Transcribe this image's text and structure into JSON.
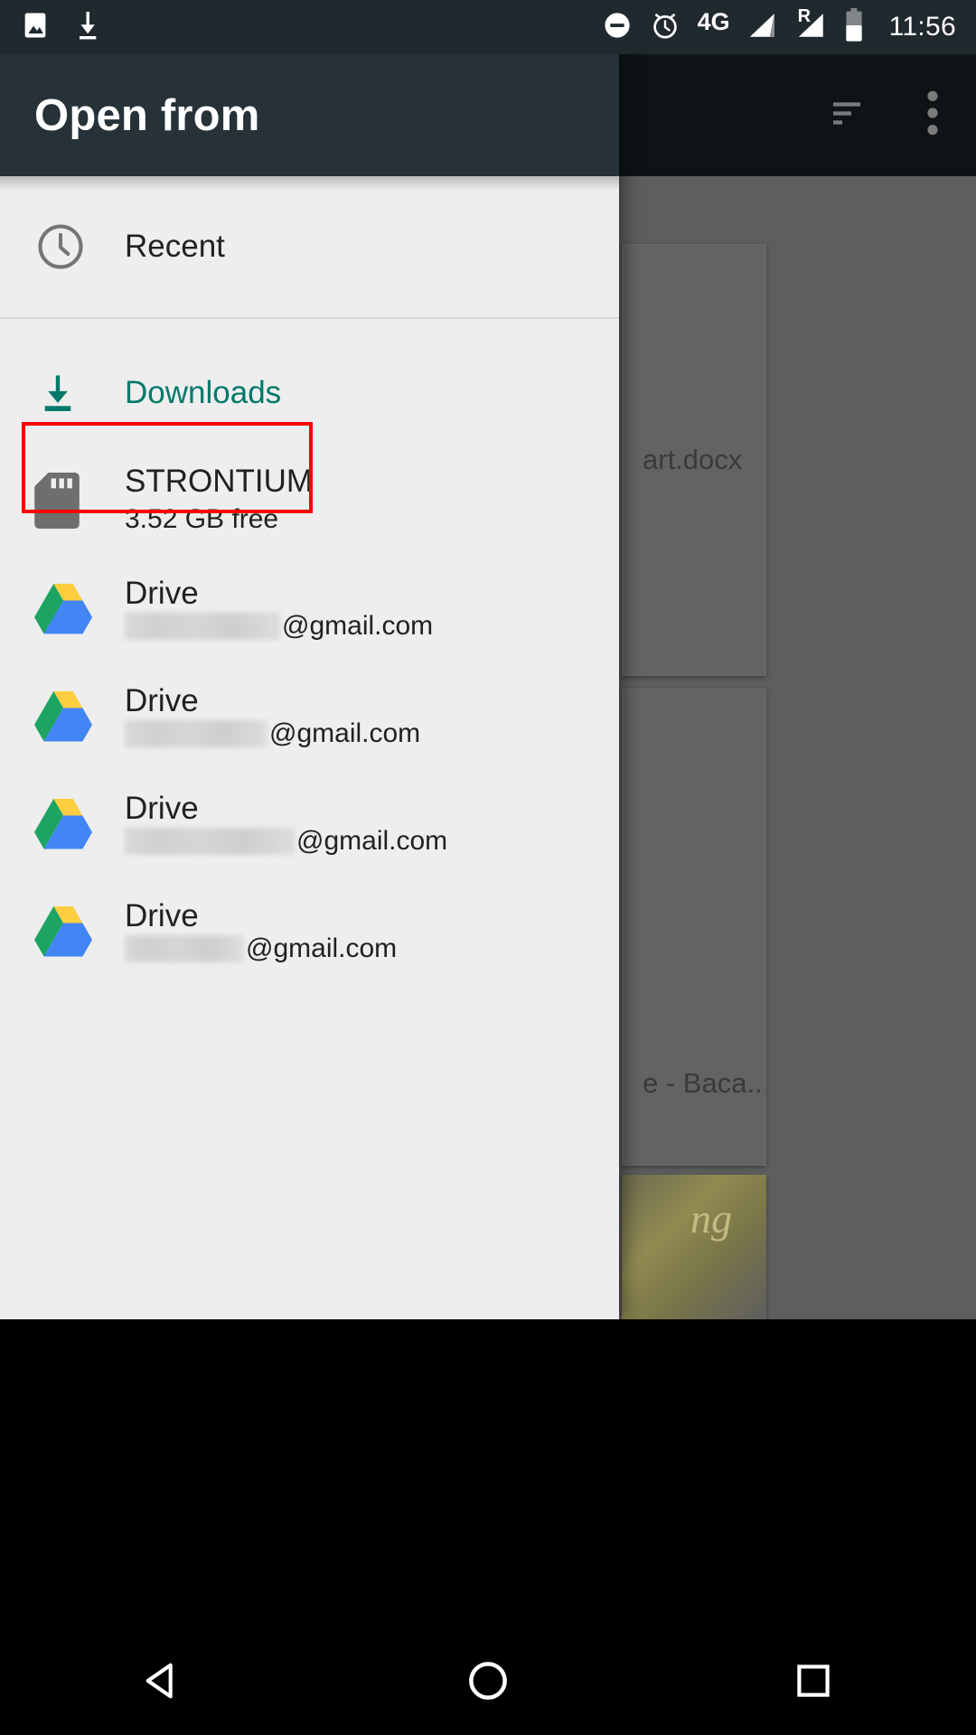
{
  "status_bar": {
    "time": "11:56",
    "icons": [
      "image-icon",
      "download-icon",
      "do-not-disturb-icon",
      "alarm-icon",
      "4g-icon",
      "signal-bar-icon",
      "roaming-signal-icon",
      "battery-icon"
    ],
    "network_label": "4G",
    "roaming_label": "R",
    "background": "#20292e"
  },
  "drawer": {
    "title": "Open from",
    "background": "#eeeeee",
    "header_background": "#263238",
    "accent_color": "#00796b",
    "sections": [
      {
        "items": [
          {
            "label": "Recent",
            "icon": "clock-icon",
            "selected": false
          }
        ]
      },
      {
        "items": [
          {
            "label": "Downloads",
            "icon": "download-icon",
            "selected": true,
            "highlight_color": "#ff0000"
          },
          {
            "label": "STRONTIUM",
            "sublabel": "3.52 GB free",
            "icon": "sd-card-icon",
            "selected": false
          },
          {
            "label": "Drive",
            "sublabel_redacted": true,
            "sublabel_domain": "@gmail.com",
            "redact_width": 172,
            "icon": "google-drive-icon",
            "selected": false
          },
          {
            "label": "Drive",
            "sublabel_redacted": true,
            "sublabel_domain": "@gmail.com",
            "redact_width": 158,
            "icon": "google-drive-icon",
            "selected": false
          },
          {
            "label": "Drive",
            "sublabel_redacted": true,
            "sublabel_domain": "@gmail.com",
            "redact_width": 188,
            "icon": "google-drive-icon",
            "selected": false
          },
          {
            "label": "Drive",
            "sublabel_redacted": true,
            "sublabel_domain": "@gmail.com",
            "redact_width": 132,
            "icon": "google-drive-icon",
            "selected": false
          }
        ]
      }
    ]
  },
  "background_app": {
    "appbar_icons": [
      "sort-icon",
      "overflow-menu-icon"
    ],
    "cards": [
      {
        "caption": "art.docx"
      },
      {
        "caption": ""
      },
      {
        "caption": "e - Baca..."
      }
    ],
    "photo_scribble": "ng"
  },
  "nav_bar": {
    "buttons": [
      "back-icon",
      "home-icon",
      "recents-icon"
    ],
    "background": "#000000"
  }
}
